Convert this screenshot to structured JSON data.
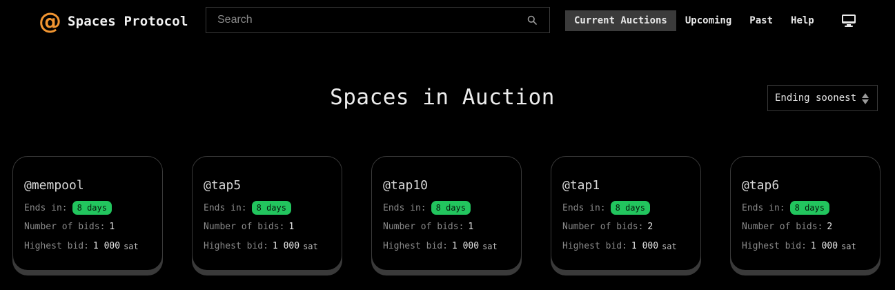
{
  "header": {
    "logo_mark": "@",
    "logo_text": "Spaces Protocol",
    "search_placeholder": "Search",
    "nav": [
      {
        "label": "Current Auctions",
        "active": true
      },
      {
        "label": "Upcoming",
        "active": false
      },
      {
        "label": "Past",
        "active": false
      },
      {
        "label": "Help",
        "active": false
      }
    ],
    "theme_icon": "monitor-icon"
  },
  "main": {
    "title": "Spaces in Auction",
    "sort_value": "Ending soonest"
  },
  "labels": {
    "ends_in": "Ends in:",
    "bids": "Number of bids:",
    "highest_bid": "Highest bid:",
    "unit": "sat"
  },
  "cards": [
    {
      "name": "@mempool",
      "ends_in": "8 days",
      "bids": "1",
      "highest_bid": "1 000"
    },
    {
      "name": "@tap5",
      "ends_in": "8 days",
      "bids": "1",
      "highest_bid": "1 000"
    },
    {
      "name": "@tap10",
      "ends_in": "8 days",
      "bids": "1",
      "highest_bid": "1 000"
    },
    {
      "name": "@tap1",
      "ends_in": "8 days",
      "bids": "2",
      "highest_bid": "1 000"
    },
    {
      "name": "@tap6",
      "ends_in": "8 days",
      "bids": "2",
      "highest_bid": "1 000"
    }
  ],
  "colors": {
    "accent": "#f19531",
    "badge": "#22c55e",
    "background": "#000000"
  }
}
